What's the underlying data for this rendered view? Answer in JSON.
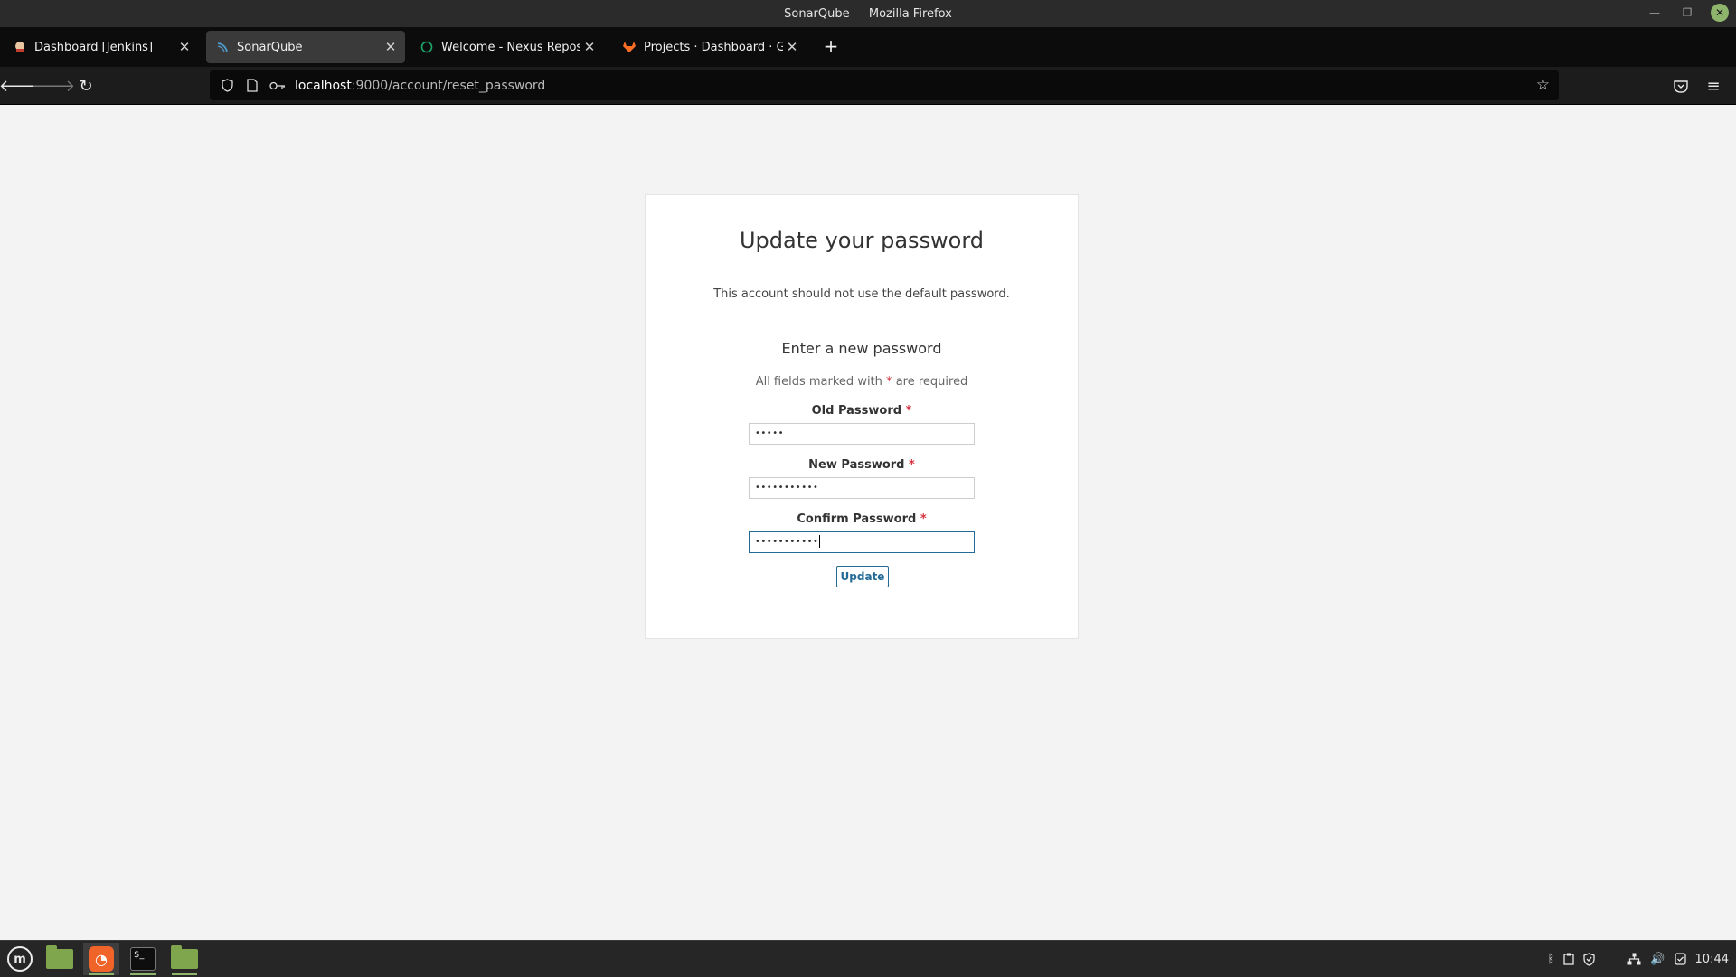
{
  "window": {
    "title": "SonarQube — Mozilla Firefox"
  },
  "tabs": [
    {
      "label": "Dashboard [Jenkins]",
      "active": false,
      "icon": "jenkins-icon"
    },
    {
      "label": "SonarQube",
      "active": true,
      "icon": "sonarqube-icon"
    },
    {
      "label": "Welcome - Nexus Repositor",
      "active": false,
      "icon": "nexus-icon"
    },
    {
      "label": "Projects · Dashboard · GitLa",
      "active": false,
      "icon": "gitlab-icon"
    }
  ],
  "urlbar": {
    "host": "localhost",
    "path": ":9000/account/reset_password"
  },
  "page": {
    "heading": "Update your password",
    "subtitle": "This account should not use the default password.",
    "section_heading": "Enter a new password",
    "required_note_prefix": "All fields marked with",
    "required_marker": "*",
    "required_note_suffix": "are required",
    "fields": [
      {
        "label": "Old Password",
        "masked_value": "•••••"
      },
      {
        "label": "New Password",
        "masked_value": "•••••••••••"
      },
      {
        "label": "Confirm Password",
        "masked_value": "•••••••••••"
      }
    ],
    "submit_label": "Update"
  },
  "taskbar": {
    "clock": "10:44"
  },
  "colors": {
    "accent": "#236a97",
    "required": "#d4333f",
    "mint_green": "#8fb56d"
  }
}
